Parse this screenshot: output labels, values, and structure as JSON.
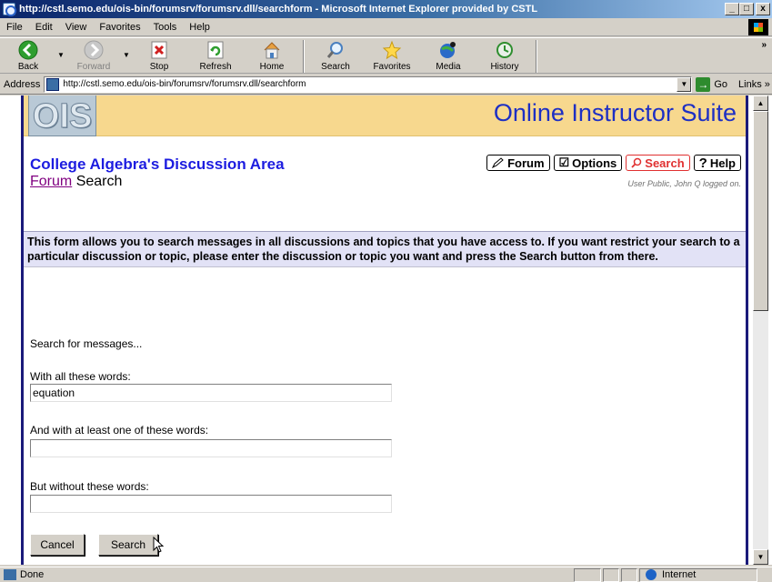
{
  "window": {
    "title": "http://cstl.semo.edu/ois-bin/forumsrv/forumsrv.dll/searchform - Microsoft Internet Explorer provided by CSTL",
    "minimize": "_",
    "maximize": "□",
    "close": "x"
  },
  "menubar": {
    "items": [
      "File",
      "Edit",
      "View",
      "Favorites",
      "Tools",
      "Help"
    ]
  },
  "toolbar": {
    "back": "Back",
    "forward": "Forward",
    "stop": "Stop",
    "refresh": "Refresh",
    "home": "Home",
    "search": "Search",
    "favorites": "Favorites",
    "media": "Media",
    "history": "History",
    "overflow": "»"
  },
  "addressbar": {
    "label": "Address",
    "url": "http://cstl.semo.edu/ois-bin/forumsrv/forumsrv.dll/searchform",
    "go": "Go",
    "links": "Links »"
  },
  "page": {
    "logo_text": "OIS",
    "suite_title": "Online Instructor Suite",
    "discussion_title": "College Algebra's Discussion Area",
    "breadcrumb_link": "Forum",
    "breadcrumb_current": "Search",
    "nav": {
      "forum": "Forum",
      "options": "Options",
      "search": "Search",
      "help": "Help"
    },
    "user_status": "User Public, John Q logged on.",
    "info": "This form allows you to search messages in all discussions and topics that you have access to. If you want restrict your search to a particular discussion or topic, please enter the discussion or topic you want and press the Search button from there.",
    "search_heading": "Search for messages...",
    "all_words_label": "With all these words:",
    "all_words_value": "equation",
    "any_words_label": "And with at least one of these words:",
    "any_words_value": "",
    "without_words_label": "But without these words:",
    "without_words_value": "",
    "cancel_button": "Cancel",
    "search_button": "Search"
  },
  "statusbar": {
    "text": "Done",
    "zone": "Internet"
  },
  "colors": {
    "banner": "#f7d88e",
    "title_blue": "#1c1ce0",
    "active_nav": "#e03030",
    "info_bg": "#e2e2f6"
  }
}
